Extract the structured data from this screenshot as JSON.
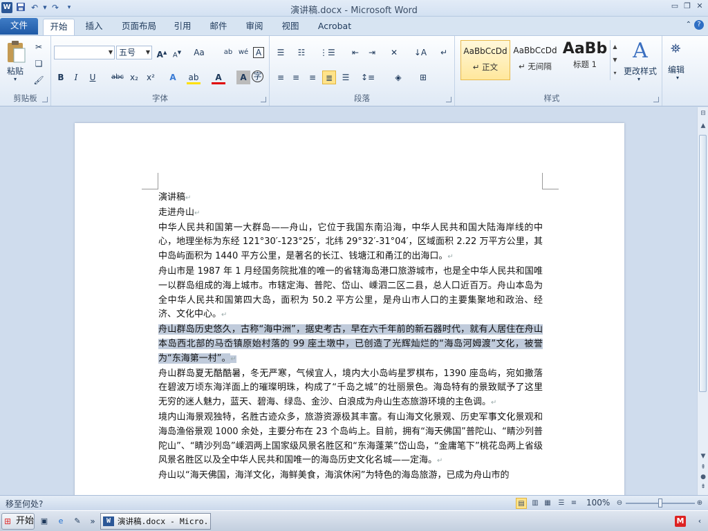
{
  "window": {
    "title": "演讲稿.docx - Microsoft Word"
  },
  "qat": {
    "word_icon": "W",
    "save_icon": "save-icon",
    "undo_icon": "undo-icon",
    "redo_icon": "redo-icon"
  },
  "tabs": [
    {
      "label": "文件"
    },
    {
      "label": "开始"
    },
    {
      "label": "插入"
    },
    {
      "label": "页面布局"
    },
    {
      "label": "引用"
    },
    {
      "label": "邮件"
    },
    {
      "label": "审阅"
    },
    {
      "label": "视图"
    },
    {
      "label": "Acrobat"
    }
  ],
  "ribbon": {
    "clipboard": {
      "label": "剪贴板",
      "paste": "粘贴"
    },
    "font": {
      "label": "字体",
      "font_name": "",
      "font_size": "五号",
      "bold": "B",
      "italic": "I",
      "underline": "U",
      "strike": "abc",
      "sub": "x₂",
      "sup": "x²",
      "grow": "A",
      "shrink": "A",
      "case": "Aa",
      "clear": "A"
    },
    "paragraph": {
      "label": "段落"
    },
    "styles": {
      "label": "样式",
      "items": [
        {
          "preview": "AaBbCcDd",
          "name": "↵ 正文"
        },
        {
          "preview": "AaBbCcDd",
          "name": "↵ 无间隔"
        },
        {
          "preview": "AaBb",
          "name": "标题 1"
        }
      ],
      "change_styles": "更改样式"
    },
    "editing": {
      "label": "编辑"
    }
  },
  "document": {
    "paragraphs": [
      {
        "text": "演讲稿",
        "highlight": false
      },
      {
        "text": "走进舟山",
        "highlight": false
      },
      {
        "text": "中华人民共和国第一大群岛——舟山，它位于我国东南沿海，中华人民共和国大陆海岸线的中心，地理坐标为东经 121°30′-123°25′，北纬 29°32′-31°04′，区域面积 2.22 万平方公里，其中岛屿面积为 1440 平方公里，是著名的长江、钱塘江和甬江的出海口。",
        "highlight": false
      },
      {
        "text": "舟山市是 1987 年 1 月经国务院批准的唯一的省辖海岛港口旅游城市，也是全中华人民共和国唯一以群岛组成的海上城市。市辖定海、普陀、岱山、嵊泗二区二县，总人口近百万。舟山本岛为全中华人民共和国第四大岛，面积为 50.2 平方公里，是舟山市人口的主要集聚地和政治、经济、文化中心。",
        "highlight": false
      },
      {
        "text": "舟山群岛历史悠久，古称“海中洲”，据史考古，早在六千年前的新石器时代，就有人居住在舟山本岛西北部的马岙镇原始村落的 99 座土墩中，已创造了光辉灿烂的“海岛河姆渡”文化，被誉为“东海第一村”。",
        "highlight": true
      },
      {
        "text": "舟山群岛夏无酷酷暑，冬无严寒，气候宜人，境内大小岛屿星罗棋布，1390 座岛屿，宛如撒落在碧波万顷东海洋面上的璀璨明珠，构成了“千岛之城”的壮丽景色。海岛特有的景致赋予了这里无穷的迷人魅力，蓝天、碧海、绿岛、金沙、白浪成为舟山生态旅游环境的主色调。",
        "highlight": false
      },
      {
        "text": "境内山海景观独特，名胜古迹众多，旅游资源极其丰富。有山海文化景观、历史军事文化景观和海岛渔俗景观 1000 余处，主要分布在 23 个岛屿上。目前，拥有“海天佛国”普陀山、“睛沙列普陀山”、“睛沙列岛”嵊泗两上国家级风景名胜区和“东海蓬莱”岱山岛，“金庸笔下”桃花岛两上省级风景名胜区以及全中华人民共和国唯一的海岛历史文化名城——定海。",
        "highlight": false
      },
      {
        "text": "舟山以“海天佛国，海洋文化，海鲜美食，海滨休闲”为特色的海岛旅游，已成为舟山市的",
        "highlight": false
      }
    ]
  },
  "status": {
    "text": "移至何处?",
    "zoom": "100%"
  },
  "taskbar": {
    "start": "开始",
    "item": "演讲稿.docx - Micro..."
  }
}
